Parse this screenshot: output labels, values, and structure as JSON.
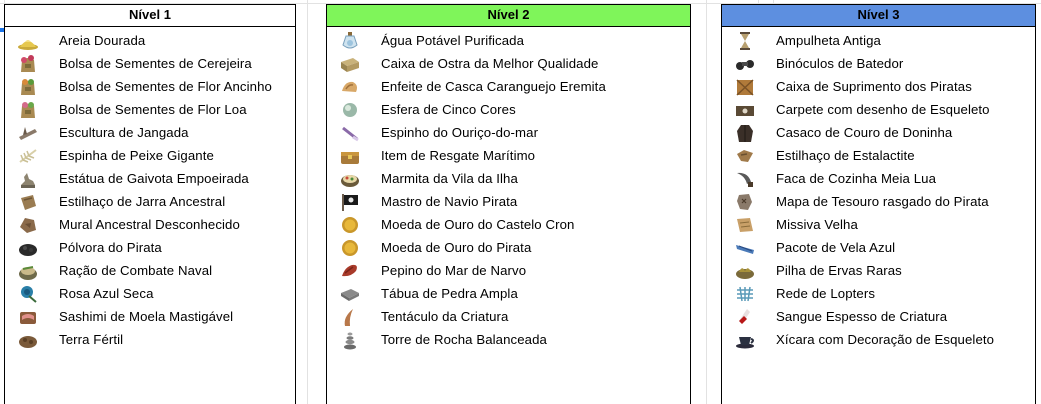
{
  "tables": [
    {
      "title": "Nível 1",
      "header_color": "#ffffff",
      "items": [
        {
          "label": "Areia Dourada",
          "icon": "golden-sand-icon"
        },
        {
          "label": "Bolsa de Sementes de Cerejeira",
          "icon": "seed-bag-icon"
        },
        {
          "label": "Bolsa de Sementes de Flor Ancinho",
          "icon": "seed-bag-icon"
        },
        {
          "label": "Bolsa de Sementes de Flor Loa",
          "icon": "seed-bag-icon"
        },
        {
          "label": "Escultura de Jangada",
          "icon": "raft-sculpture-icon"
        },
        {
          "label": "Espinha de Peixe Gigante",
          "icon": "fish-bone-icon"
        },
        {
          "label": "Estátua de Gaivota Empoeirada",
          "icon": "seagull-statue-icon"
        },
        {
          "label": "Estilhaço de Jarra Ancestral",
          "icon": "jar-shard-icon"
        },
        {
          "label": "Mural Ancestral Desconhecido",
          "icon": "mural-stone-icon"
        },
        {
          "label": "Pólvora do Pirata",
          "icon": "gunpowder-icon"
        },
        {
          "label": "Ração de Combate Naval",
          "icon": "ration-icon"
        },
        {
          "label": "Rosa Azul Seca",
          "icon": "blue-rose-icon"
        },
        {
          "label": "Sashimi de Moela Mastigável",
          "icon": "sashimi-icon"
        },
        {
          "label": "Terra Fértil",
          "icon": "fertile-soil-icon"
        }
      ]
    },
    {
      "title": "Nível 2",
      "header_color": "#7ff55a",
      "items": [
        {
          "label": "Água Potável Purificada",
          "icon": "water-flask-icon"
        },
        {
          "label": "Caixa de Ostra da Melhor Qualidade",
          "icon": "oyster-box-icon"
        },
        {
          "label": "Enfeite de Casca Caranguejo Eremita",
          "icon": "hermit-shell-icon"
        },
        {
          "label": "Esfera de Cinco Cores",
          "icon": "five-color-orb-icon"
        },
        {
          "label": "Espinho do Ouriço-do-mar",
          "icon": "urchin-spine-icon"
        },
        {
          "label": "Item de Resgate Marítimo",
          "icon": "rescue-chest-icon"
        },
        {
          "label": "Marmita da Vila da Ilha",
          "icon": "lunchbox-icon"
        },
        {
          "label": "Mastro de Navio Pirata",
          "icon": "pirate-flag-icon"
        },
        {
          "label": "Moeda de Ouro do Castelo Cron",
          "icon": "gold-coin-icon"
        },
        {
          "label": "Moeda de Ouro do Pirata",
          "icon": "gold-coin-icon"
        },
        {
          "label": "Pepino do Mar de Narvo",
          "icon": "sea-cucumber-icon"
        },
        {
          "label": "Tábua de Pedra Ampla",
          "icon": "stone-slab-icon"
        },
        {
          "label": "Tentáculo da Criatura",
          "icon": "tentacle-icon"
        },
        {
          "label": "Torre de Rocha Balanceada",
          "icon": "stacked-rocks-icon"
        }
      ]
    },
    {
      "title": "Nível 3",
      "header_color": "#5d8fe0",
      "items": [
        {
          "label": "Ampulheta Antiga",
          "icon": "hourglass-icon"
        },
        {
          "label": "Binóculos de Batedor",
          "icon": "binoculars-icon"
        },
        {
          "label": "Caixa de Suprimento dos Piratas",
          "icon": "supply-crate-icon"
        },
        {
          "label": "Carpete com desenho de Esqueleto",
          "icon": "skull-carpet-icon"
        },
        {
          "label": "Casaco de Couro de Doninha",
          "icon": "leather-coat-icon"
        },
        {
          "label": "Estilhaço de Estalactite",
          "icon": "stalactite-shard-icon"
        },
        {
          "label": "Faca de Cozinha Meia Lua",
          "icon": "crescent-knife-icon"
        },
        {
          "label": "Mapa de Tesouro rasgado do Pirata",
          "icon": "treasure-map-icon"
        },
        {
          "label": "Missiva Velha",
          "icon": "old-letter-icon"
        },
        {
          "label": "Pacote de Vela Azul",
          "icon": "blue-sail-icon"
        },
        {
          "label": "Pilha de Ervas Raras",
          "icon": "herb-pile-icon"
        },
        {
          "label": "Rede de Lopters",
          "icon": "net-icon"
        },
        {
          "label": "Sangue Espesso de Criatura",
          "icon": "blood-vial-icon"
        },
        {
          "label": "Xícara com Decoração de Esqueleto",
          "icon": "skull-teacup-icon"
        }
      ]
    }
  ]
}
